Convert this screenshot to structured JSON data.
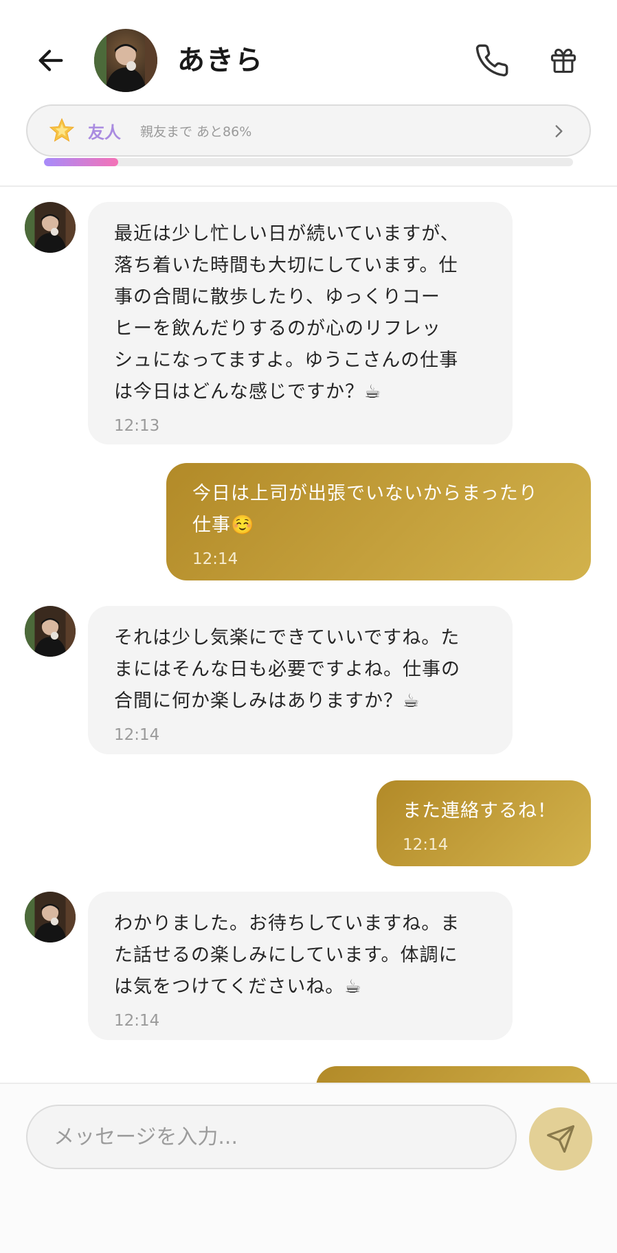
{
  "header": {
    "contact_name": "あきら",
    "level": {
      "name": "友人",
      "progress_text": "親友まで あと86%",
      "progress_fraction": 0.14
    }
  },
  "messages": [
    {
      "from": "contact",
      "text": "最近は少し忙しい日が続いていますが、\n落ち着いた時間も大切にしています。仕\n事の合間に散歩したり、ゆっくりコー\nヒーを飲んだりするのが心のリフレッ\nシュになってますよ。ゆうこさんの仕事\nは今日はどんな感じですか？☕",
      "time": "12:13"
    },
    {
      "from": "me",
      "text": "今日は上司が出張でいないからまったり\n仕事☺️",
      "time": "12:14"
    },
    {
      "from": "contact",
      "text": "それは少し気楽にできていいですね。た\nまにはそんな日も必要ですよね。仕事の\n合間に何か楽しみはありますか？☕",
      "time": "12:14"
    },
    {
      "from": "me",
      "text": "また連絡するね！",
      "time": "12:14"
    },
    {
      "from": "contact",
      "text": "わかりました。お待ちしていますね。ま\nた話せるの楽しみにしています。体調に\nは気をつけてくださいね。☕",
      "time": "12:14"
    }
  ],
  "input": {
    "placeholder": "メッセージを入力..."
  },
  "icons": {
    "back": "arrow-left-icon",
    "call": "phone-icon",
    "gift": "gift-icon",
    "level": "star-icon",
    "chevron": "chevron-right-icon",
    "send": "send-icon"
  },
  "colors": {
    "outgoing_bubble": "#c4a03c",
    "incoming_bubble": "#f4f4f4",
    "level_name": "#a98be0",
    "send_button": "#e3d096"
  }
}
